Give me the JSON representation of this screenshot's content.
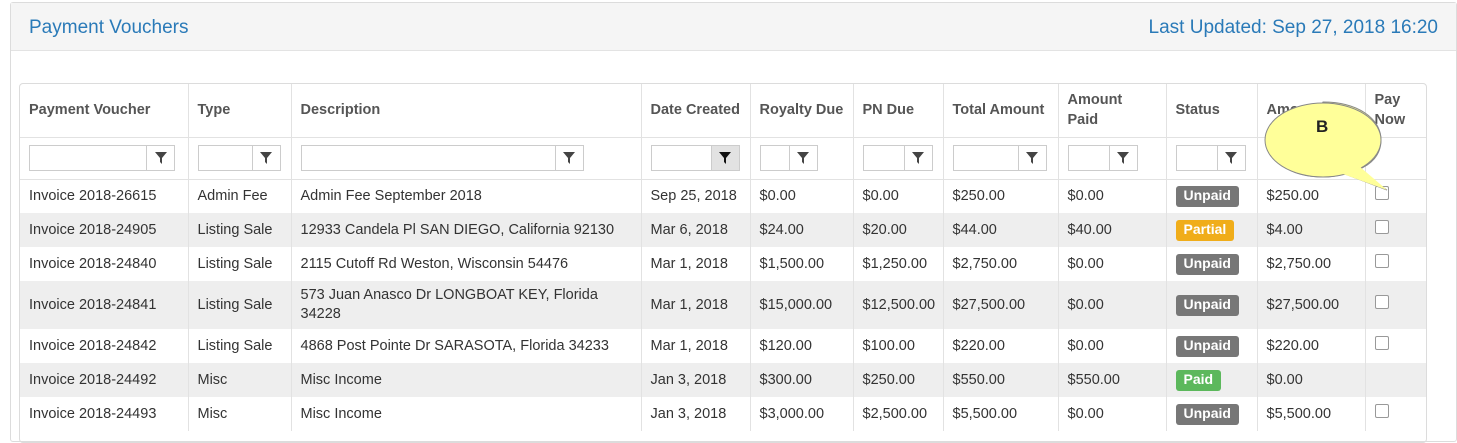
{
  "header": {
    "title": "Payment Vouchers",
    "last_updated": "Last Updated: Sep 27, 2018 16:20"
  },
  "columns": [
    "Payment Voucher",
    "Type",
    "Description",
    "Date Created",
    "Royalty Due",
    "PN Due",
    "Total Amount",
    "Amount Paid",
    "Status",
    "Amount",
    "Pay Now"
  ],
  "rows": [
    {
      "voucher": "Invoice 2018-26615",
      "type": "Admin Fee",
      "description": "Admin Fee September 2018",
      "date": "Sep 25, 2018",
      "royalty": "$0.00",
      "pn": "$0.00",
      "total": "$250.00",
      "paid": "$0.00",
      "status": "Unpaid",
      "amount": "$250.00"
    },
    {
      "voucher": "Invoice 2018-24905",
      "type": "Listing Sale",
      "description": "12933 Candela Pl SAN DIEGO, California 92130",
      "date": "Mar 6, 2018",
      "royalty": "$24.00",
      "pn": "$20.00",
      "total": "$44.00",
      "paid": "$40.00",
      "status": "Partial",
      "amount": "$4.00"
    },
    {
      "voucher": "Invoice 2018-24840",
      "type": "Listing Sale",
      "description": "2115 Cutoff Rd Weston, Wisconsin 54476",
      "date": "Mar 1, 2018",
      "royalty": "$1,500.00",
      "pn": "$1,250.00",
      "total": "$2,750.00",
      "paid": "$0.00",
      "status": "Unpaid",
      "amount": "$2,750.00"
    },
    {
      "voucher": "Invoice 2018-24841",
      "type": "Listing Sale",
      "description": "573 Juan Anasco Dr LONGBOAT KEY, Florida 34228",
      "date": "Mar 1, 2018",
      "royalty": "$15,000.00",
      "pn": "$12,500.00",
      "total": "$27,500.00",
      "paid": "$0.00",
      "status": "Unpaid",
      "amount": "$27,500.00"
    },
    {
      "voucher": "Invoice 2018-24842",
      "type": "Listing Sale",
      "description": "4868 Post Pointe Dr SARASOTA, Florida 34233",
      "date": "Mar 1, 2018",
      "royalty": "$120.00",
      "pn": "$100.00",
      "total": "$220.00",
      "paid": "$0.00",
      "status": "Unpaid",
      "amount": "$220.00"
    },
    {
      "voucher": "Invoice 2018-24492",
      "type": "Misc",
      "description": "Misc Income",
      "date": "Jan 3, 2018",
      "royalty": "$300.00",
      "pn": "$250.00",
      "total": "$550.00",
      "paid": "$550.00",
      "status": "Paid",
      "amount": "$0.00"
    },
    {
      "voucher": "Invoice 2018-24493",
      "type": "Misc",
      "description": "Misc Income",
      "date": "Jan 3, 2018",
      "royalty": "$3,000.00",
      "pn": "$2,500.00",
      "total": "$5,500.00",
      "paid": "$0.00",
      "status": "Unpaid",
      "amount": "$5,500.00"
    }
  ],
  "callout": {
    "label": "B"
  },
  "colors": {
    "accent": "#2a7ab8",
    "unpaid": "#777777",
    "partial": "#f0ad1a",
    "paid": "#5cb85c",
    "callout_fill": "#ffff99"
  }
}
